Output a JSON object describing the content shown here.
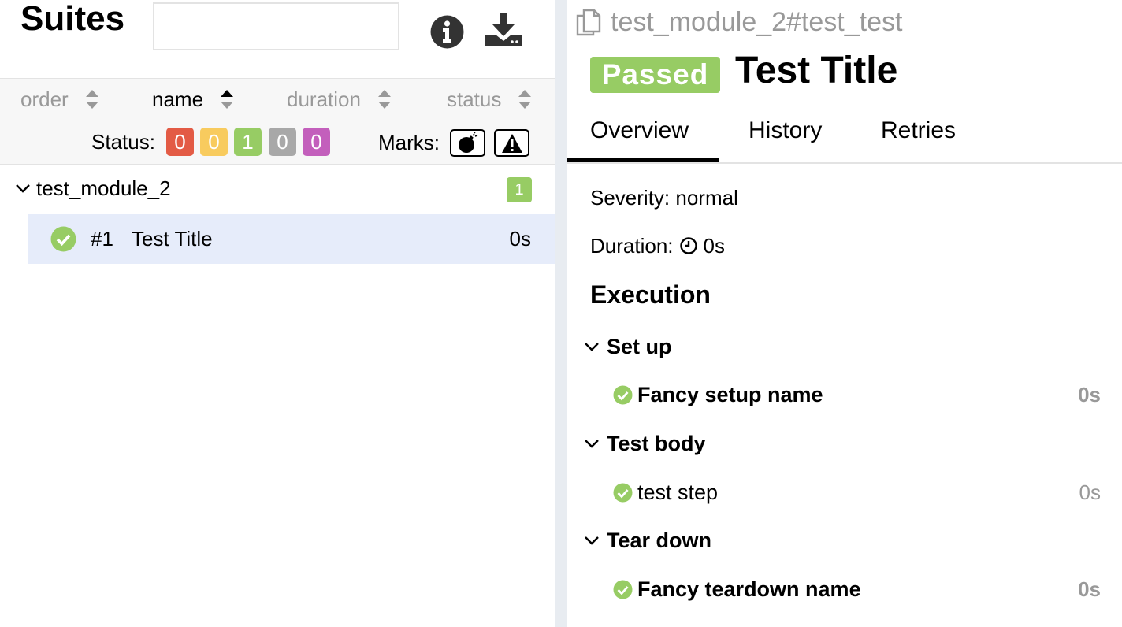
{
  "colors": {
    "failed": "#e35b45",
    "broken": "#f8cb5e",
    "passed": "#97cc64",
    "skipped": "#a8a8a8",
    "unknown": "#c35fbc",
    "selected_row": "#e6ecfa"
  },
  "sidebar": {
    "title": "Suites",
    "search_value": "",
    "sort_columns": [
      {
        "label": "order"
      },
      {
        "label": "name"
      },
      {
        "label": "duration"
      },
      {
        "label": "status"
      }
    ],
    "status_label": "Status:",
    "status_counts": [
      "0",
      "0",
      "1",
      "0",
      "0"
    ],
    "marks_label": "Marks:",
    "marks": [
      "bomb-icon",
      "warning-icon"
    ],
    "groups": [
      {
        "name": "test_module_2",
        "count": "1",
        "tests": [
          {
            "num": "#1",
            "title": "Test Title",
            "duration": "0s",
            "status": "passed"
          }
        ]
      }
    ]
  },
  "detail": {
    "breadcrumb": "test_module_2#test_test",
    "status_badge": "Passed",
    "title": "Test Title",
    "tabs": [
      "Overview",
      "History",
      "Retries"
    ],
    "severity": "Severity: normal",
    "duration_label": "Duration:",
    "duration_value": "0s",
    "execution_heading": "Execution",
    "stages": [
      {
        "label": "Set up",
        "step": {
          "name": "Fancy setup name",
          "duration": "0s",
          "bold": true
        }
      },
      {
        "label": "Test body",
        "step": {
          "name": "test step",
          "duration": "0s",
          "bold": false
        }
      },
      {
        "label": "Tear down",
        "step": {
          "name": "Fancy teardown name",
          "duration": "0s",
          "bold": true
        }
      }
    ]
  }
}
